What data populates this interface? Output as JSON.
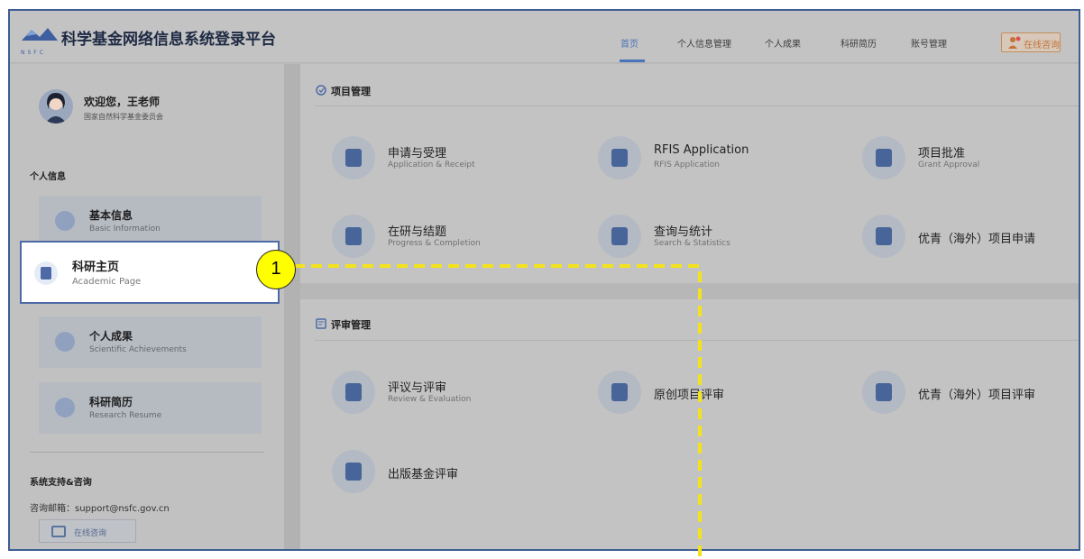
{
  "header": {
    "app_title": "科学基金网络信息系统登录平台",
    "logo_caption": "NSFC",
    "nav": [
      "首页",
      "个人信息管理",
      "个人成果",
      "科研简历",
      "账号管理"
    ],
    "consult_label": "在线咨询"
  },
  "sidebar": {
    "welcome": "欢迎您，王老师",
    "org": "国家自然科学基金委员会",
    "section_personal": "个人信息",
    "items": [
      {
        "title": "基本信息",
        "subtitle": "Basic Information"
      },
      {
        "title": "科研主页",
        "subtitle": "Academic Page"
      },
      {
        "title": "个人成果",
        "subtitle": "Scientific Achievements"
      },
      {
        "title": "科研简历",
        "subtitle": "Research Resume"
      }
    ],
    "support_title": "系统支持&咨询",
    "support_mail": "咨询邮箱：support@nsfc.gov.cn",
    "online_btn": "在线咨询"
  },
  "main": {
    "project_title": "项目管理",
    "project_tiles": [
      {
        "title": "申请与受理",
        "subtitle": "Application & Receipt"
      },
      {
        "title": "RFIS Application",
        "subtitle": "RFIS Application"
      },
      {
        "title": "项目批准",
        "subtitle": "Grant Approval"
      },
      {
        "title": "在研与结题",
        "subtitle": "Progress & Completion"
      },
      {
        "title": "查询与统计",
        "subtitle": "Search & Statistics"
      },
      {
        "title": "优青（海外）项目申请",
        "subtitle": ""
      }
    ],
    "review_title": "评审管理",
    "review_tiles": [
      {
        "title": "评议与评审",
        "subtitle": "Review & Evaluation"
      },
      {
        "title": "原创项目评审",
        "subtitle": ""
      },
      {
        "title": "优青（海外）项目评审",
        "subtitle": ""
      },
      {
        "title": "出版基金评审",
        "subtitle": ""
      }
    ]
  },
  "annotation": {
    "number": "1"
  }
}
